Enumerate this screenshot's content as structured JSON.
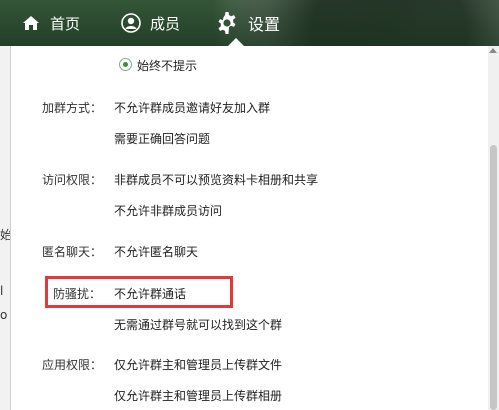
{
  "nav": {
    "home_label": "首页",
    "member_label": "成员",
    "settings_label": "设置"
  },
  "settings": {
    "never_prompt": "始终不提示",
    "join_label": "加群方式：",
    "join_opt1": "不允许群成员邀请好友加入群",
    "join_opt2": "需要正确回答问题",
    "access_label": "访问权限：",
    "access_opt1": "非群成员不可以预览资料卡相册和共享",
    "access_opt2": "不允许非群成员访问",
    "anon_label": "匿名聊天：",
    "anon_opt1": "不允许匿名聊天",
    "anti_label": "防骚扰：",
    "anti_opt1": "不允许群通话",
    "anti_opt2": "无需通过群号就可以找到这个群",
    "app_label": "应用权限：",
    "app_opt1": "仅允许群主和管理员上传群文件",
    "app_opt2": "仅允许群主和管理员上传群相册"
  },
  "left_strip": [
    "始",
    "l",
    "o"
  ],
  "colors": {
    "highlight": "#e23a3a",
    "accent_green": "#3f8b3f"
  }
}
